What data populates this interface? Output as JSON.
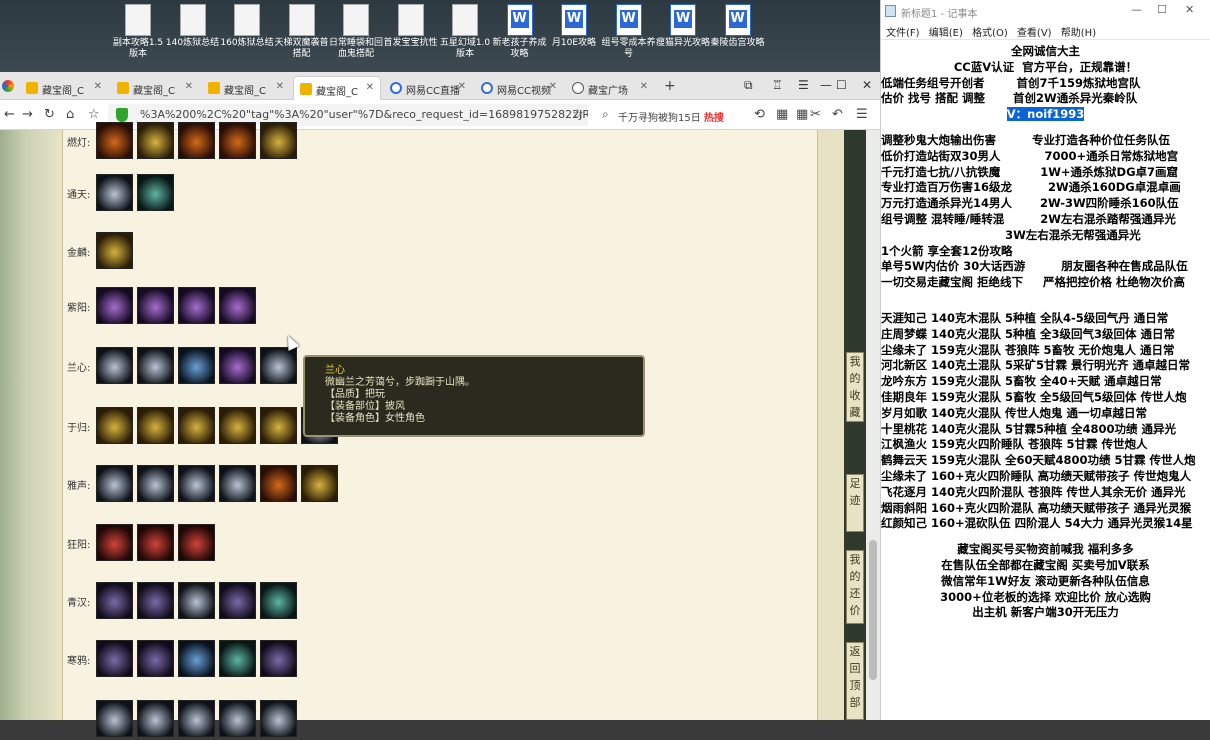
{
  "desktop": {
    "icons": [
      {
        "label": "副本攻略1.5版本",
        "type": "doc"
      },
      {
        "label": "140炼狱总结",
        "type": "doc"
      },
      {
        "label": "160炼狱总结",
        "type": "doc"
      },
      {
        "label": "天梯双魔袭普搭配",
        "type": "doc"
      },
      {
        "label": "日常睡袋和回血鬼搭配",
        "type": "doc"
      },
      {
        "label": "首发宝宝抗性",
        "type": "doc"
      },
      {
        "label": "五星幻域1.0版本",
        "type": "doc"
      },
      {
        "label": "新老孩子养成攻略",
        "type": "word"
      },
      {
        "label": "月10E攻略",
        "type": "word"
      },
      {
        "label": "组号零成本养号",
        "type": "word"
      },
      {
        "label": "瘦猫异光攻略",
        "type": "word"
      },
      {
        "label": "秦陵齿宫攻略",
        "type": "word"
      }
    ]
  },
  "browser": {
    "tabs": [
      {
        "label": "藏宝阁_C",
        "icon": "treasure-icon",
        "active": false
      },
      {
        "label": "藏宝阁_C",
        "icon": "treasure-icon",
        "active": false
      },
      {
        "label": "藏宝阁_C",
        "icon": "treasure-icon",
        "active": false
      },
      {
        "label": "藏宝阁_C",
        "icon": "treasure-icon",
        "active": true
      },
      {
        "label": "网易CC直播",
        "icon": "cc-icon",
        "active": false
      },
      {
        "label": "网易CC视频",
        "icon": "cc-icon",
        "active": false
      },
      {
        "label": "藏宝广场",
        "icon": "globe-icon",
        "active": false
      }
    ],
    "new_tab": "+",
    "url": "%3A%200%2C%20\"tag\"%3A%20\"user\"%7D&reco_request_id=1689819752822JREkX",
    "search_text": "千万寻狗被狗15日",
    "search_hot": "热搜"
  },
  "page": {
    "rows": [
      {
        "label": "燃灯:",
        "items": [
          "r",
          "g",
          "r",
          "r",
          "g"
        ]
      },
      {
        "label": "通天:",
        "items": [
          "s",
          "t"
        ]
      },
      {
        "label": "金麟:",
        "items": [
          "g"
        ]
      },
      {
        "label": "紫阳:",
        "items": [
          "p",
          "p",
          "p",
          "p"
        ]
      },
      {
        "label": "兰心:",
        "items": [
          "s",
          "s",
          "b",
          "p",
          "s"
        ]
      },
      {
        "label": "于归:",
        "items": [
          "g",
          "g",
          "g",
          "g",
          "g",
          "s"
        ]
      },
      {
        "label": "雅声:",
        "items": [
          "s",
          "s",
          "s",
          "s",
          "r",
          "g"
        ]
      },
      {
        "label": "狂阳:",
        "items": [
          "c",
          "c",
          "c"
        ]
      },
      {
        "label": "青汉:",
        "items": [
          "v",
          "v",
          "s",
          "v",
          "t"
        ]
      },
      {
        "label": "寒鸦:",
        "items": [
          "v",
          "v",
          "b",
          "t",
          "v"
        ]
      },
      {
        "label": "",
        "items": [
          "s",
          "s",
          "s",
          "s",
          "s"
        ]
      }
    ],
    "tooltip": {
      "name": "兰心",
      "desc": "微幽兰之芳蔼兮，步踟蹰于山隅。",
      "quality": "【品质】把玩",
      "slot": "【装备部位】披风",
      "role": "【装备角色】女性角色"
    },
    "side_buttons": [
      {
        "label": "我的收藏"
      },
      {
        "label": "足迹"
      },
      {
        "label": "我的还价"
      },
      {
        "label": "返回顶部"
      }
    ]
  },
  "notepad": {
    "title": "新标题1 - 记事本",
    "menu": [
      "文件(F)",
      "编辑(E)",
      "格式(O)",
      "查看(V)",
      "帮助(H)"
    ],
    "lines": [
      {
        "t": "全网诚信大主",
        "c": true
      },
      {
        "t": "CC蓝V认证  官方平台，正规靠谱！",
        "c": true
      },
      {
        "t": "低端任务组号开创者        首创7千159炼狱地宫队",
        "c": false
      },
      {
        "t": "估价 找号 搭配 调整       首创2W通杀异光秦岭队",
        "c": false
      },
      {
        "t": "V：noif1993",
        "c": true,
        "hl": true
      },
      {
        "gap": true
      },
      {
        "t": "调整秒鬼大炮输出伤害         专业打造各种价位任务队伍",
        "c": false
      },
      {
        "t": "低价打造站街双30男人           7000+通杀日常炼狱地宫",
        "c": false
      },
      {
        "t": "千元打造七抗/八抗铁魔          1W+通杀炼狱DG卓7画窟",
        "c": false
      },
      {
        "t": "专业打造百万伤害16级龙         2W通杀160DG卓混卓画",
        "c": false
      },
      {
        "t": "万元打造通杀异光14男人       2W-3W四阶睡杀160队伍",
        "c": false
      },
      {
        "t": "组号调整 混转睡/睡转混         2W左右混杀踏帮强通异光",
        "c": false
      },
      {
        "t": "                               3W左右混杀无帮强通异光",
        "c": false
      },
      {
        "t": "1个火箭 享全套12份攻略",
        "c": false
      },
      {
        "t": "单号5W内估价 30大话西游         朋友圈各种在售成品队伍",
        "c": false
      },
      {
        "t": "一切交易走藏宝阁 拒绝线下     严格把控价格 杜绝物次价高",
        "c": false
      },
      {
        "gap": true
      },
      {
        "gap": true
      },
      {
        "t": "天涯知己 140克木混队 5种植 全队4-5级回气丹 通日常",
        "c": false
      },
      {
        "t": "庄周梦蝶 140克火混队 5种植 全3级回气3级回体 通日常",
        "c": false
      },
      {
        "t": "尘缘未了 159克火混队 苍狼阵 5畜牧 无价炮鬼人 通日常",
        "c": false
      },
      {
        "t": "河北新区 140克土混队 5采矿5甘霖 景行明光齐 通卓越日常",
        "c": false
      },
      {
        "t": "龙吟东方 159克火混队 5畜牧 全40+天赋 通卓越日常",
        "c": false
      },
      {
        "t": "佳期良年 159克火混队 5畜牧 全5级回气5级回体 传世人炮",
        "c": false
      },
      {
        "t": "岁月如歌 140克火混队 传世人炮鬼 通一切卓越日常",
        "c": false
      },
      {
        "t": "十里桃花 140克火混队 5甘霖5种植 全4800功绩 通异光",
        "c": false
      },
      {
        "t": "江枫渔火 159克火四阶睡队 苍狼阵 5甘霖 传世炮人",
        "c": false
      },
      {
        "t": "鹤舞云天 159克火混队 全60天赋4800功绩 5甘霖 传世人炮",
        "c": false
      },
      {
        "t": "尘缘未了 160+克火四阶睡队 高功绩天赋带孩子 传世炮鬼人",
        "c": false
      },
      {
        "t": "飞花逐月 140克火四阶混队 苍狼阵 传世人其余无价 通异光",
        "c": false
      },
      {
        "t": "烟雨斜阳 160+克火四阶混队 高功绩天赋带孩子 通异光灵猴",
        "c": false
      },
      {
        "t": "红颜知己 160+混砍队伍 四阶混人 54大力 通异光灵猴14星",
        "c": false
      },
      {
        "gap": true
      },
      {
        "t": "藏宝阁买号买物资前喊我 福利多多",
        "c": true
      },
      {
        "t": "在售队伍全部都在藏宝阁 买卖号加V联系",
        "c": true
      },
      {
        "t": "微信常年1W好友 滚动更新各种队伍信息",
        "c": true
      },
      {
        "t": "3000+位老板的选择 欢迎比价 放心选购",
        "c": true
      },
      {
        "t": "出主机 新客户端30开无压力",
        "c": true
      }
    ]
  }
}
